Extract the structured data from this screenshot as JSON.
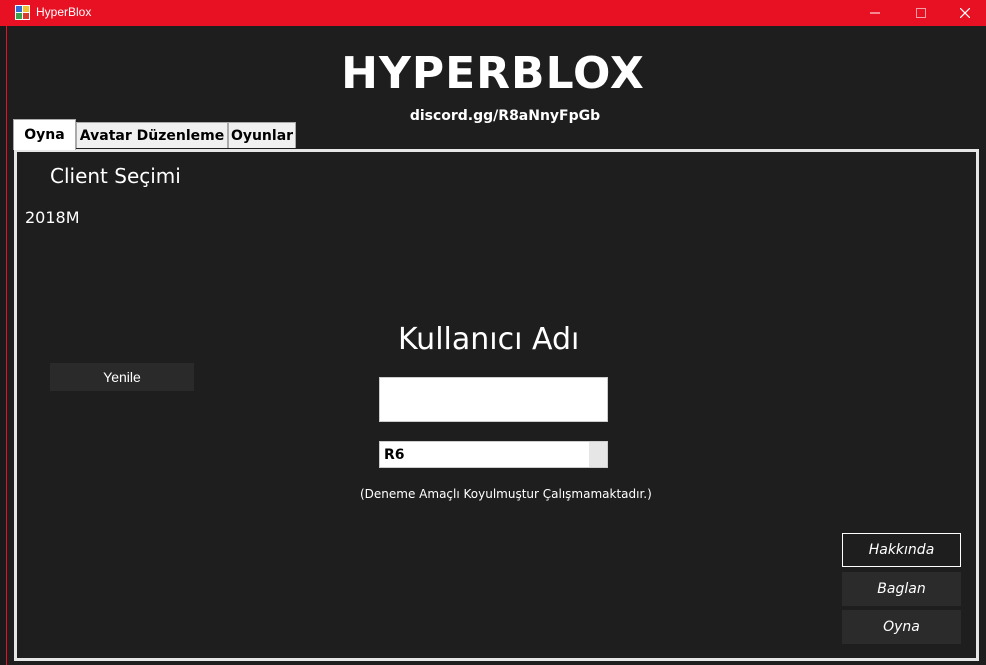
{
  "window": {
    "title": "HyperBlox",
    "minimize_icon": "minimize-icon",
    "maximize_icon": "maximize-icon",
    "close_icon": "close-icon",
    "accent": "#e81123"
  },
  "header": {
    "title": "HYPERBLOX",
    "discord": "discord.gg/R8aNnyFpGb"
  },
  "tabs": [
    {
      "label": "Oyna"
    },
    {
      "label": "Avatar Düzenleme"
    },
    {
      "label": "Oyunlar"
    }
  ],
  "play": {
    "client_label": "Client Seçimi",
    "clients": [
      "2018M"
    ],
    "refresh_button": "Yenile",
    "username_label": "Kullanıcı Adı",
    "username_value": "",
    "rig_selected": "R6",
    "note": "(Deneme Amaçlı Koyulmuştur Çalışmamaktadır.)",
    "about_button": "Hakkında",
    "connect_button": "Baglan",
    "play_button": "Oyna"
  }
}
